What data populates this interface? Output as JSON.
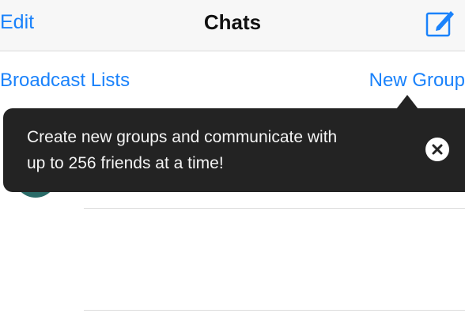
{
  "navbar": {
    "edit_label": "Edit",
    "title": "Chats",
    "compose_icon": "compose-icon"
  },
  "toolbar": {
    "broadcast_label": "Broadcast Lists",
    "new_group_label": "New Group"
  },
  "tooltip": {
    "line1": "Create new groups and communicate with",
    "line2": "up to 256 friends at a time!",
    "close_icon": "close-icon"
  },
  "colors": {
    "accent": "#1a82fb",
    "tooltip_bg": "#232323",
    "navbar_bg": "#f7f7f7"
  }
}
